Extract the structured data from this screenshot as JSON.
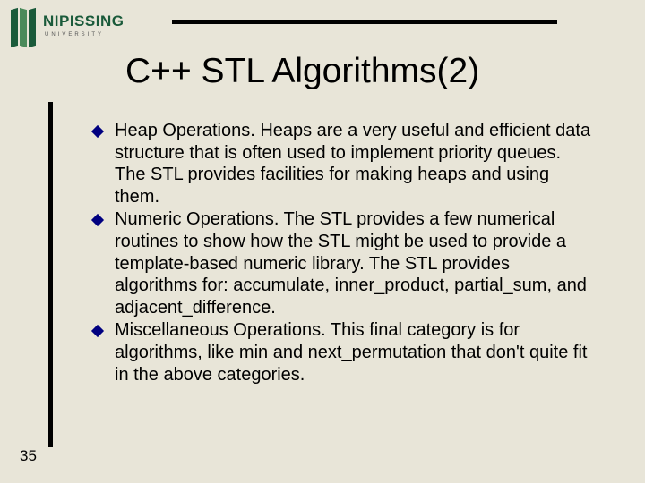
{
  "logo": {
    "name": "NIPISSING",
    "sub": "UNIVERSITY"
  },
  "title": "C++ STL Algorithms(2)",
  "bullets": [
    "Heap Operations. Heaps are a very useful and efficient data structure that is often used to implement priority queues. The STL provides facilities for making heaps and using them.",
    "Numeric Operations. The STL provides a few numerical routines to show how the STL might be used to provide a template-based numeric library. The STL provides algorithms for: accumulate, inner_product, partial_sum, and adjacent_difference.",
    "Miscellaneous Operations. This final category is for algorithms, like min and next_permutation that don't quite fit in the above categories."
  ],
  "page_number": "35"
}
